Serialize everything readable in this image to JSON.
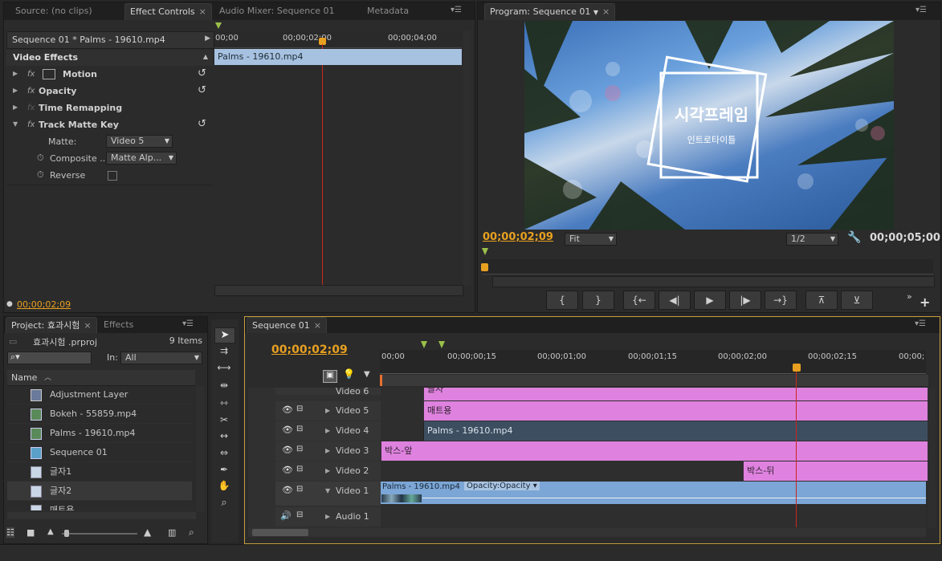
{
  "effect_controls": {
    "tabs": [
      {
        "label": "Source: (no clips)"
      },
      {
        "label": "Effect Controls",
        "close": "×"
      },
      {
        "label": "Audio Mixer: Sequence 01"
      },
      {
        "label": "Metadata"
      }
    ],
    "sequence_label": "Sequence 01 * Palms - 19610.mp4",
    "ruler": [
      "00;00",
      "00;00;02;00",
      "00;00;04;00"
    ],
    "clip_label": "Palms - 19610.mp4",
    "video_effects_label": "Video Effects",
    "effects": [
      {
        "name": "Motion"
      },
      {
        "name": "Opacity"
      },
      {
        "name": "Time Remapping"
      },
      {
        "name": "Track Matte Key"
      }
    ],
    "fx_label": "fx",
    "params": {
      "matte_label": "Matte:",
      "matte_value": "Video 5",
      "composite_label": "Composite ...",
      "composite_value": "Matte Alp...",
      "reverse_label": "Reverse"
    },
    "timecode": "00;00;02;09"
  },
  "program_monitor": {
    "tab_label": "Program: Sequence 01",
    "close": "×",
    "title_main": "시각프레임",
    "title_sub": "인트로타이틀",
    "timecode": "00;00;02;09",
    "fit_value": "Fit",
    "resolution_value": "1/2",
    "duration": "00;00;05;00",
    "buttons": [
      {
        "name": "mark-in",
        "glyph": "{"
      },
      {
        "name": "mark-out",
        "glyph": "}"
      },
      {
        "name": "go-to-in",
        "glyph": "{←"
      },
      {
        "name": "step-back",
        "glyph": "◀|"
      },
      {
        "name": "play",
        "glyph": "▶"
      },
      {
        "name": "step-forward",
        "glyph": "|▶"
      },
      {
        "name": "go-to-out",
        "glyph": "→}"
      },
      {
        "name": "lift",
        "glyph": "⊼"
      },
      {
        "name": "extract",
        "glyph": "⊻"
      }
    ]
  },
  "project": {
    "tabs": [
      {
        "label": "Project: 효과시험",
        "close": "×"
      },
      {
        "label": "Effects"
      }
    ],
    "file_name": "효과시험 .prproj",
    "item_count": "9 Items",
    "search_placeholder": "",
    "in_label": "In:",
    "in_value": "All",
    "name_header": "Name",
    "items": [
      {
        "label": "Adjustment Layer",
        "icon": "adjustment-layer-icon"
      },
      {
        "label": "Bokeh - 55859.mp4",
        "icon": "video-clip-icon"
      },
      {
        "label": "Palms - 19610.mp4",
        "icon": "video-clip-icon"
      },
      {
        "label": "Sequence 01",
        "icon": "sequence-icon"
      },
      {
        "label": "글자1",
        "icon": "title-icon"
      },
      {
        "label": "글자2",
        "icon": "title-icon"
      },
      {
        "label": "매트용",
        "icon": "title-icon"
      }
    ]
  },
  "tools": [
    "selection-tool",
    "track-select-tool",
    "ripple-edit-tool",
    "rolling-edit-tool",
    "rate-stretch-tool",
    "razor-tool",
    "slip-tool",
    "slide-tool",
    "pen-tool",
    "hand-tool",
    "zoom-tool"
  ],
  "timeline": {
    "tab_label": "Sequence 01",
    "close": "×",
    "timecode": "00;00;02;09",
    "ruler": [
      "00;00",
      "00;00;00;15",
      "00;00;01;00",
      "00;00;01;15",
      "00;00;02;00",
      "00;00;02;15",
      "00;00;"
    ],
    "tracks": [
      {
        "name": "Video 6",
        "clips": [
          {
            "label": "글자",
            "type": "pink"
          }
        ]
      },
      {
        "name": "Video 5",
        "clips": [
          {
            "label": "매트용",
            "type": "pink"
          }
        ]
      },
      {
        "name": "Video 4",
        "clips": [
          {
            "label": "Palms - 19610.mp4",
            "type": "blue"
          }
        ]
      },
      {
        "name": "Video 3",
        "clips": [
          {
            "label": "박스-앞",
            "type": "pink"
          }
        ]
      },
      {
        "name": "Video 2",
        "clips": [
          {
            "label": "박스-뒤",
            "type": "pink"
          }
        ]
      },
      {
        "name": "Video 1",
        "clips": [
          {
            "label": "Palms - 19610.mp4",
            "type": "expanded"
          }
        ]
      },
      {
        "name": "Audio 1",
        "clips": []
      }
    ],
    "opacity_label": "Opacity:Opacity"
  },
  "colors": {
    "accent_timecode": "#e8a020",
    "clip_pink": "#df82df",
    "clip_blue": "#3d4e60",
    "playhead": "#c8281e"
  }
}
